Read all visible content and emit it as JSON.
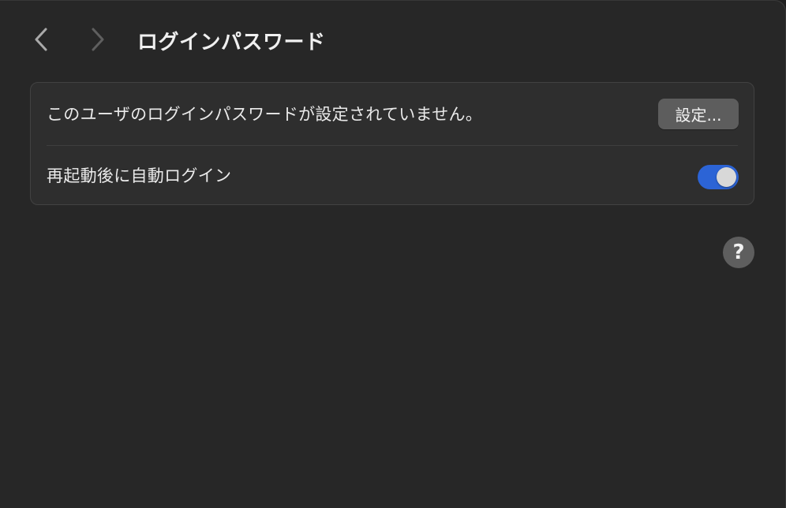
{
  "window": {
    "title": "ログインパスワード"
  },
  "navigation": {
    "back_icon": "chevron-left-icon",
    "forward_icon": "chevron-right-icon"
  },
  "settings": {
    "password_row": {
      "label": "このユーザのログインパスワードが設定されていません。",
      "button_label": "設定..."
    },
    "auto_login_row": {
      "label": "再起動後に自動ログイン",
      "toggle_on": true
    }
  },
  "help": {
    "label": "?"
  },
  "colors": {
    "window_background": "#272727",
    "card_background": "#2e2e2e",
    "toggle_accent": "#2c64d6",
    "button_background": "#5d5d5d"
  }
}
